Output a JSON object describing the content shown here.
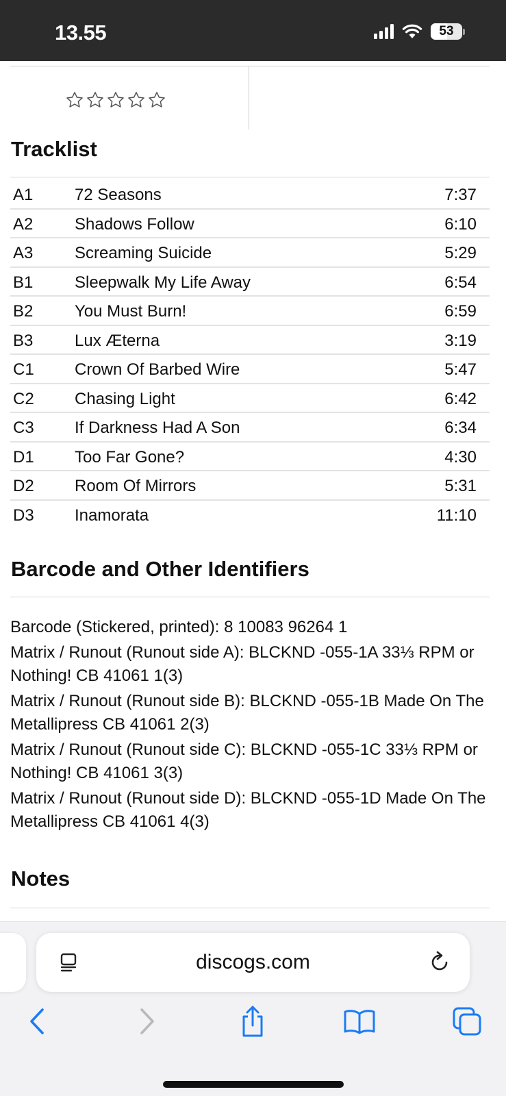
{
  "status_bar": {
    "time": "13.55",
    "battery": "53"
  },
  "rating": {
    "stars_total": 5,
    "stars_filled": 0
  },
  "tracklist": {
    "title": "Tracklist",
    "tracks": [
      {
        "position": "A1",
        "title": "72 Seasons",
        "duration": "7:37"
      },
      {
        "position": "A2",
        "title": "Shadows Follow",
        "duration": "6:10"
      },
      {
        "position": "A3",
        "title": "Screaming Suicide",
        "duration": "5:29"
      },
      {
        "position": "B1",
        "title": "Sleepwalk My Life Away",
        "duration": "6:54"
      },
      {
        "position": "B2",
        "title": "You Must Burn!",
        "duration": "6:59"
      },
      {
        "position": "B3",
        "title": "Lux Æterna",
        "duration": "3:19"
      },
      {
        "position": "C1",
        "title": "Crown Of Barbed Wire",
        "duration": "5:47"
      },
      {
        "position": "C2",
        "title": "Chasing Light",
        "duration": "6:42"
      },
      {
        "position": "C3",
        "title": "If Darkness Had A Son",
        "duration": "6:34"
      },
      {
        "position": "D1",
        "title": "Too Far Gone?",
        "duration": "4:30"
      },
      {
        "position": "D2",
        "title": "Room Of Mirrors",
        "duration": "5:31"
      },
      {
        "position": "D3",
        "title": "Inamorata",
        "duration": "11:10"
      }
    ]
  },
  "identifiers": {
    "title": "Barcode and Other Identifiers",
    "items": [
      "Barcode (Stickered, printed): 8 10083 96264 1",
      "Matrix / Runout (Runout side A): BLCKND -055-1A 33⅓ RPM or Nothing! CB 41061 1(3)",
      "Matrix / Runout (Runout side B): BLCKND -055-1B Made On The Metallipress CB 41061 2(3)",
      "Matrix / Runout (Runout side C): BLCKND -055-1C 33⅓ RPM or Nothing! CB 41061 3(3)",
      "Matrix / Runout (Runout side D): BLCKND -055-1D Made On The Metallipress CB 41061 4(3)"
    ]
  },
  "notes": {
    "title": "Notes"
  },
  "browser": {
    "url": "discogs.com",
    "accent_color": "#1a7cf5",
    "icons": [
      "reader-icon",
      "reload-icon",
      "back-icon",
      "forward-icon",
      "share-icon",
      "bookmarks-icon",
      "tabs-icon"
    ]
  }
}
